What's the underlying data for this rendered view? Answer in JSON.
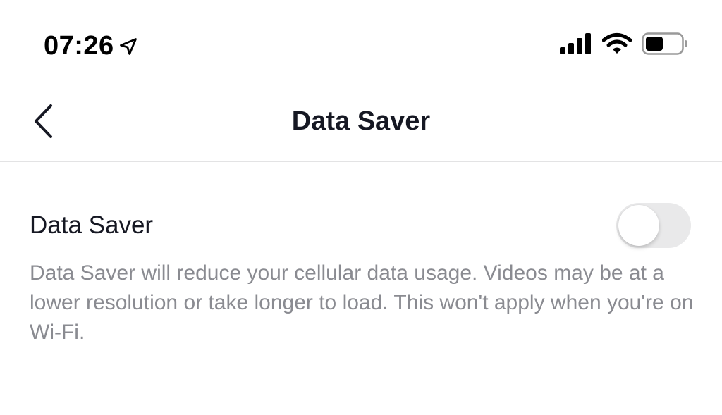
{
  "status_bar": {
    "time": "07:26",
    "icons": [
      "location-arrow-icon",
      "cellular-signal-icon",
      "wifi-icon",
      "battery-icon"
    ],
    "battery_level": 0.5
  },
  "nav": {
    "back_icon": "chevron-left-icon",
    "title": "Data Saver"
  },
  "setting": {
    "label": "Data Saver",
    "enabled": false,
    "description": "Data Saver will reduce your cellular data usage. Videos may be at a lower resolution or take longer to load. This won't apply when you're on Wi-Fi."
  },
  "colors": {
    "text_primary": "#161823",
    "text_secondary": "#8a8b91",
    "toggle_off_track": "#e9e9ea",
    "divider": "#e3e3e4"
  }
}
